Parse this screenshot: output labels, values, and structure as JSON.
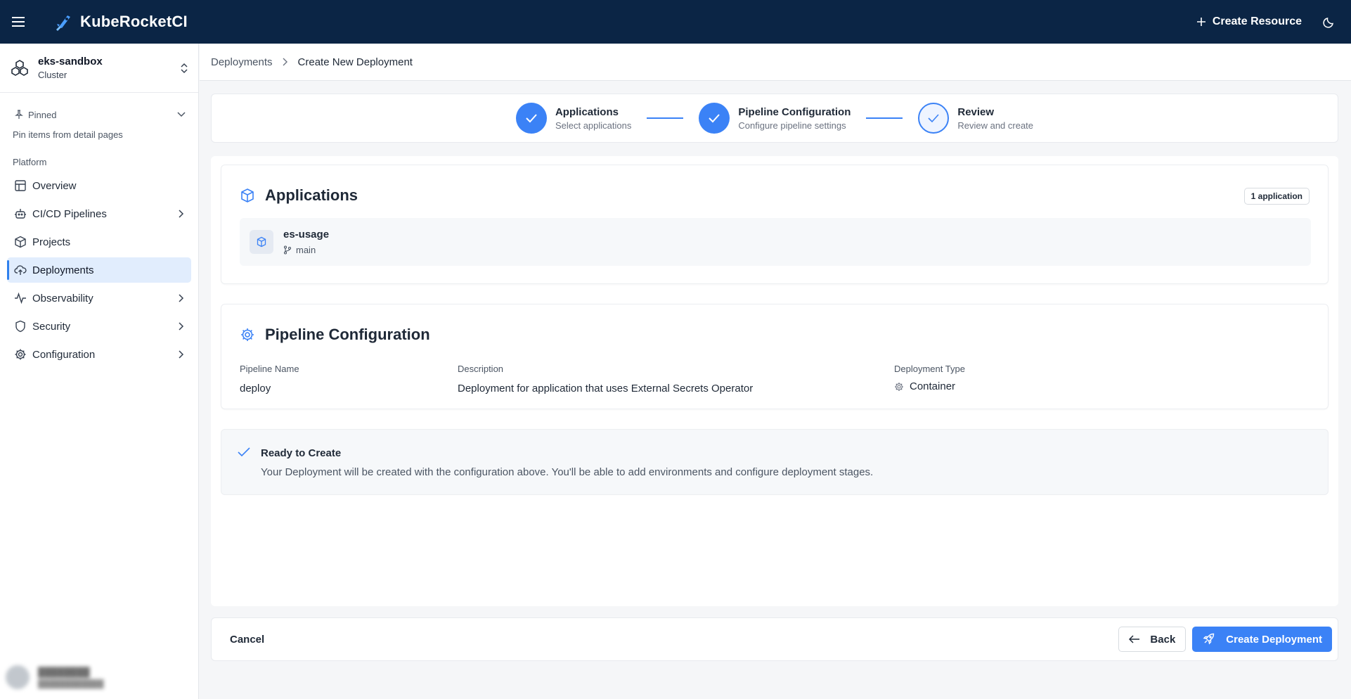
{
  "header": {
    "brand": "KubeRocketCI",
    "create_resource_label": "Create Resource",
    "icons": {
      "menu": "hamburger-icon",
      "logo": "rocket-logo",
      "theme": "moon-icon",
      "plus": "plus-icon"
    }
  },
  "sidebar": {
    "cluster_name": "eks-sandbox",
    "cluster_type": "Cluster",
    "pinned_label": "Pinned",
    "pinned_hint": "Pin items from detail pages",
    "section_label": "Platform",
    "items": [
      {
        "label": "Overview",
        "icon": "layout-icon",
        "has_children": false,
        "active": false
      },
      {
        "label": "CI/CD Pipelines",
        "icon": "bot-icon",
        "has_children": true,
        "active": false
      },
      {
        "label": "Projects",
        "icon": "box-icon",
        "has_children": false,
        "active": false
      },
      {
        "label": "Deployments",
        "icon": "cloud-upload-icon",
        "has_children": false,
        "active": true
      },
      {
        "label": "Observability",
        "icon": "activity-icon",
        "has_children": true,
        "active": false
      },
      {
        "label": "Security",
        "icon": "shield-icon",
        "has_children": true,
        "active": false
      },
      {
        "label": "Configuration",
        "icon": "gear-icon",
        "has_children": true,
        "active": false
      }
    ]
  },
  "breadcrumb": {
    "parent": "Deployments",
    "current": "Create New Deployment"
  },
  "stepper": {
    "steps": [
      {
        "title": "Applications",
        "subtitle": "Select applications",
        "state": "complete"
      },
      {
        "title": "Pipeline Configuration",
        "subtitle": "Configure pipeline settings",
        "state": "complete"
      },
      {
        "title": "Review",
        "subtitle": "Review and create",
        "state": "current"
      }
    ]
  },
  "applications": {
    "title": "Applications",
    "badge": "1 application",
    "items": [
      {
        "name": "es-usage",
        "branch": "main"
      }
    ]
  },
  "pipeline": {
    "title": "Pipeline Configuration",
    "fields": [
      {
        "label": "Pipeline Name",
        "value": "deploy"
      },
      {
        "label": "Description",
        "value": "Deployment for application that uses External Secrets Operator"
      },
      {
        "label": "Deployment Type",
        "value": "Container"
      }
    ]
  },
  "ready": {
    "title": "Ready to Create",
    "text": "Your Deployment will be created with the configuration above. You'll be able to add environments and configure deployment stages."
  },
  "footer": {
    "cancel_label": "Cancel",
    "back_label": "Back",
    "create_label": "Create Deployment"
  },
  "colors": {
    "header_bg": "#0b2545",
    "accent": "#3b82f6",
    "active_nav_bg": "#e1edfd"
  }
}
